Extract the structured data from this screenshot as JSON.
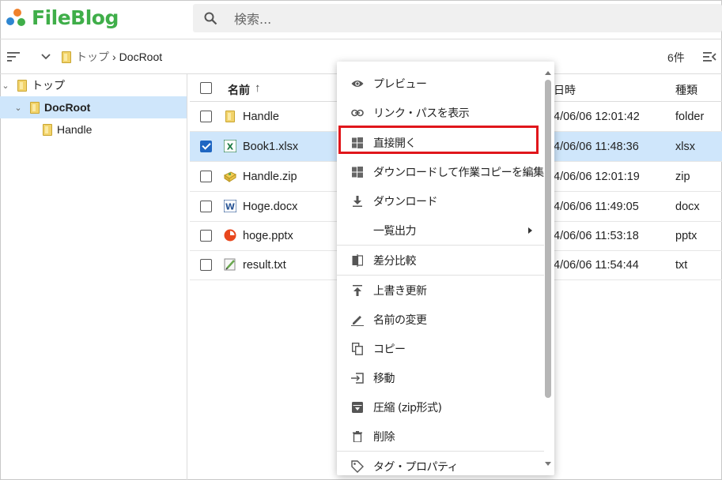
{
  "app": {
    "title": "FileBlog"
  },
  "search": {
    "placeholder": "検索..."
  },
  "breadcrumb": {
    "root": "トップ",
    "current": "DocRoot"
  },
  "count": "6件",
  "tree": [
    {
      "label": "トップ"
    },
    {
      "label": "DocRoot",
      "selected": true
    },
    {
      "label": "Handle"
    }
  ],
  "columns": {
    "name": "名前",
    "date": "日時",
    "type": "種類"
  },
  "files": [
    {
      "name": "Handle",
      "date": "4/06/06 12:01:42",
      "type": "folder",
      "icon": "folder-icon",
      "checked": false
    },
    {
      "name": "Book1.xlsx",
      "date": "4/06/06 11:48:36",
      "type": "xlsx",
      "icon": "excel-icon",
      "checked": true
    },
    {
      "name": "Handle.zip",
      "date": "4/06/06 12:01:19",
      "type": "zip",
      "icon": "zip-icon",
      "checked": false
    },
    {
      "name": "Hoge.docx",
      "date": "4/06/06 11:49:05",
      "type": "docx",
      "icon": "word-icon",
      "checked": false
    },
    {
      "name": "hoge.pptx",
      "date": "4/06/06 11:53:18",
      "type": "pptx",
      "icon": "powerpoint-icon",
      "checked": false
    },
    {
      "name": "result.txt",
      "date": "4/06/06 11:54:44",
      "type": "txt",
      "icon": "text-file-icon",
      "checked": false
    }
  ],
  "menu": {
    "items": [
      {
        "label": "プレビュー",
        "icon": "eye-icon"
      },
      {
        "label": "リンク・パスを表示",
        "icon": "link-icon"
      },
      {
        "label": "直接開く",
        "icon": "windows-icon",
        "highlighted": true
      },
      {
        "label": "ダウンロードして作業コピーを編集",
        "icon": "windows-icon"
      },
      {
        "label": "ダウンロード",
        "icon": "download-icon"
      },
      {
        "label": "一覧出力",
        "icon": "",
        "submenu": true
      },
      {
        "label": "差分比較",
        "icon": "compare-icon"
      },
      {
        "label": "上書き更新",
        "icon": "upload-icon"
      },
      {
        "label": "名前の変更",
        "icon": "pencil-icon"
      },
      {
        "label": "コピー",
        "icon": "copy-icon"
      },
      {
        "label": "移動",
        "icon": "move-icon"
      },
      {
        "label": "圧縮 (zip形式)",
        "icon": "archive-icon"
      },
      {
        "label": "削除",
        "icon": "trash-icon"
      },
      {
        "label": "タグ・プロパティ",
        "icon": "tag-icon"
      }
    ]
  },
  "colors": {
    "accent": "#3fae49",
    "selection": "#cfe6fb",
    "checkbox": "#1f66c2",
    "highlight_border": "#e0161b"
  }
}
